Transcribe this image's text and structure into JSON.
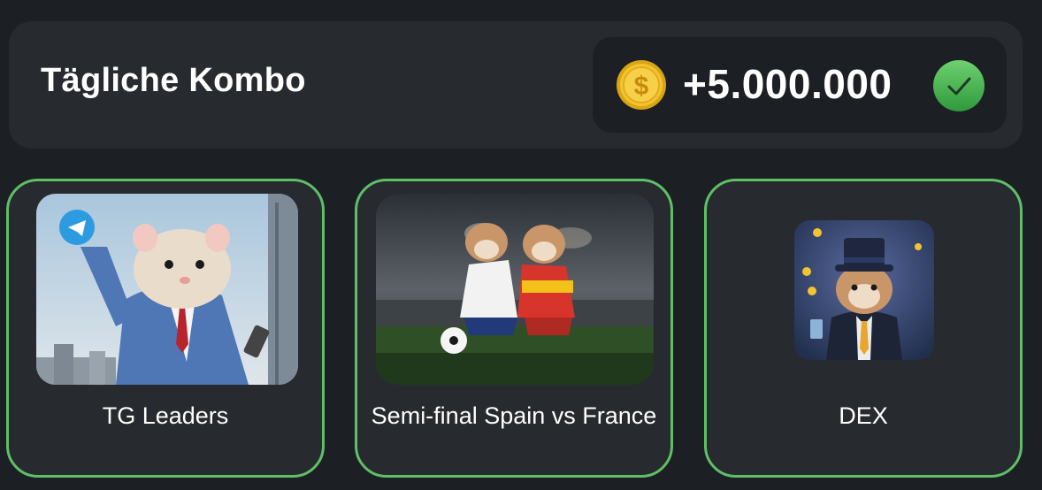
{
  "header": {
    "title": "Tägliche Kombo",
    "reward_amount": "+5.000.000",
    "coin_icon": "coin-icon",
    "status_icon": "check-icon"
  },
  "cards": [
    {
      "label": "TG Leaders",
      "image": "hamster-businessman-telegram-illustration"
    },
    {
      "label": "Semi-final Spain vs France",
      "image": "hamsters-playing-football-illustration"
    },
    {
      "label": "DEX",
      "image": "hamster-top-hat-illustration"
    }
  ],
  "colors": {
    "background": "#1c1f24",
    "panel": "#272a2f",
    "card_border": "#5fbf67",
    "coin": "#f3c431",
    "check": "#4caf50"
  }
}
